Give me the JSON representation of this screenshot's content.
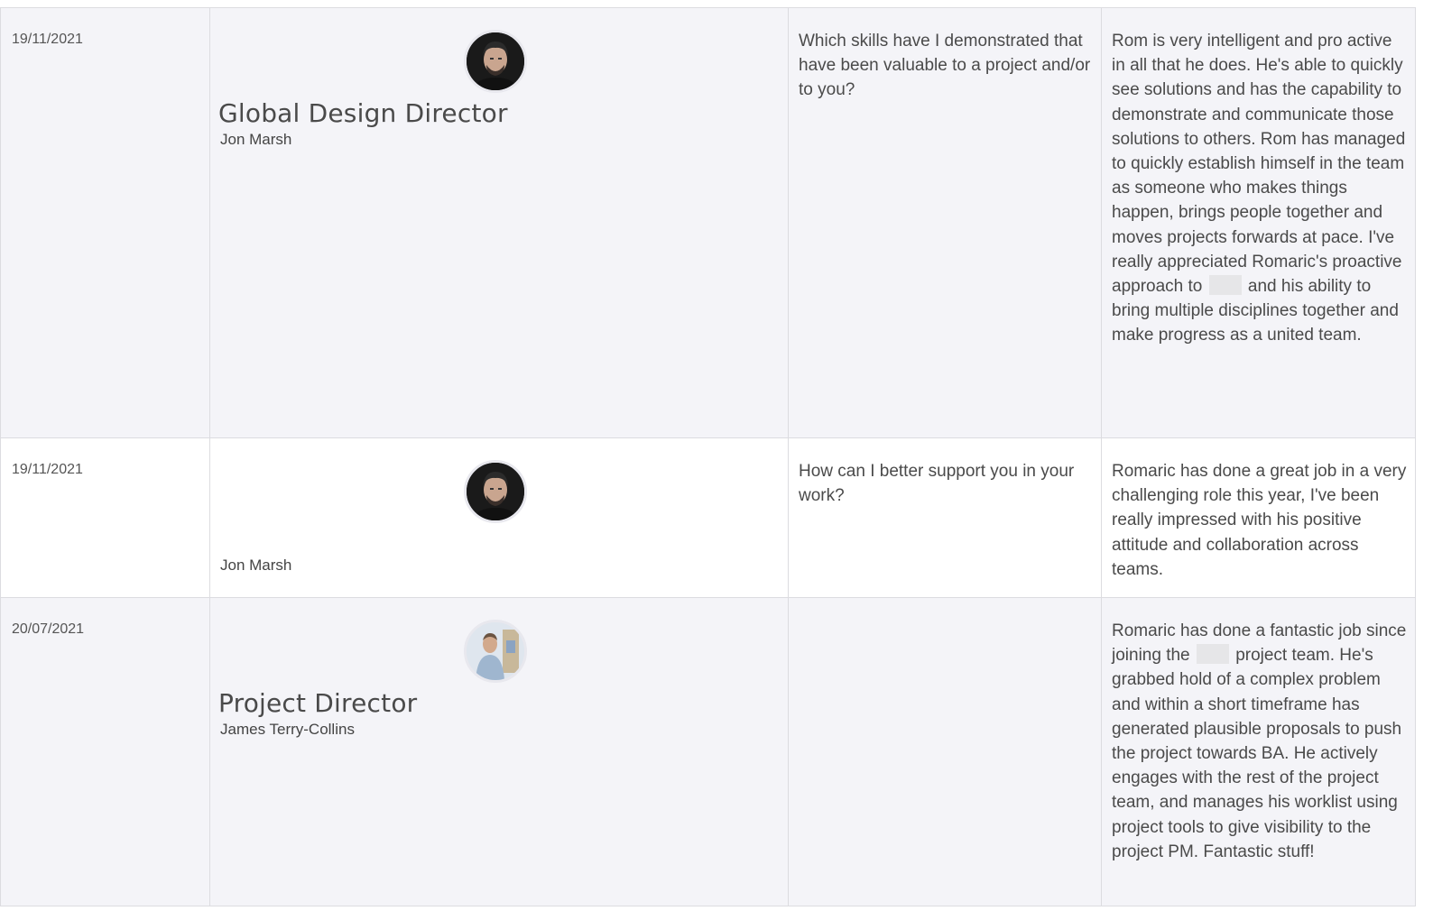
{
  "rows": [
    {
      "date": "19/11/2021",
      "role": "Global Design Director",
      "name": "Jon Marsh",
      "avatar_icon": "person-photo-dark-icon",
      "question": "Which skills have I demonstrated that have been valuable to a project and/or to you?",
      "answer_part1": "Rom is very intelligent and pro active in all that he does. He's able to quickly see solutions and has the capability to demonstrate and communicate those solutions to others. Rom has managed to quickly establish himself in the team as someone who makes things happen, brings people together and moves projects forwards at pace. I've really appreciated Romaric's proactive approach to",
      "answer_part2": "and his ability to bring multiple disciplines together and make progress as a united team."
    },
    {
      "date": "19/11/2021",
      "role": "",
      "name": "Jon Marsh",
      "avatar_icon": "person-photo-dark-icon",
      "question": "How can I better support you in your work?",
      "answer": "Romaric has done a great job in a very challenging role this year, I've been really impressed with his positive attitude and collaboration across teams."
    },
    {
      "date": "20/07/2021",
      "role": "Project Director",
      "name": "James Terry-Collins",
      "avatar_icon": "person-photo-light-icon",
      "question": "",
      "answer_part1": "Romaric has done a fantastic job since joining the",
      "answer_part2": "project team. He's grabbed hold of a complex problem and within a short timeframe has generated plausible proposals to push the project towards BA. He actively engages with the rest of the project team, and manages his worklist using project tools to give visibility to the project PM. Fantastic stuff!"
    }
  ]
}
